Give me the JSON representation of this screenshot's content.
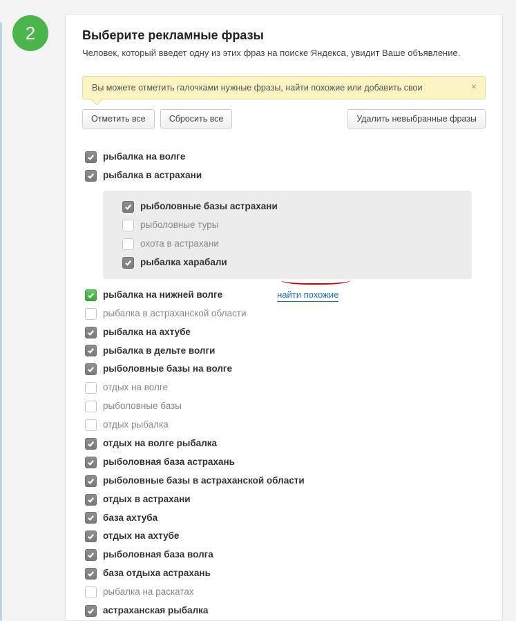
{
  "step_number": "2",
  "title": "Выберите рекламные фразы",
  "subtitle": "Человек, который введет одну из этих фраз на поиске Яндекса, увидит Ваше объявление.",
  "hint": "Вы можете отметить галочками нужные фразы, найти похожие или добавить свои",
  "buttons": {
    "select_all": "Отметить все",
    "reset_all": "Сбросить все",
    "delete_unselected": "Удалить невыбранные фразы"
  },
  "link_similar": "найти похожие",
  "phrases_top": [
    {
      "label": "рыбалка на волге",
      "state": "checked-grey"
    },
    {
      "label": "рыбалка в астрахани",
      "state": "checked-grey"
    }
  ],
  "nested_phrases": [
    {
      "label": "рыболовные базы астрахани",
      "state": "checked-grey"
    },
    {
      "label": "рыболовные туры",
      "state": "unchecked"
    },
    {
      "label": "охота в астрахани",
      "state": "unchecked"
    },
    {
      "label": "рыбалка харабали",
      "state": "checked-grey"
    }
  ],
  "phrases_main": [
    {
      "label": "рыбалка на нижней волге",
      "state": "checked-green",
      "link": true
    },
    {
      "label": "рыбалка в астраханской области",
      "state": "unchecked"
    },
    {
      "label": "рыбалка на ахтубе",
      "state": "checked-grey"
    },
    {
      "label": "рыбалка в дельте волги",
      "state": "checked-grey"
    },
    {
      "label": "рыболовные базы на волге",
      "state": "checked-grey"
    },
    {
      "label": "отдых на волге",
      "state": "unchecked"
    },
    {
      "label": "рыболовные базы",
      "state": "unchecked"
    },
    {
      "label": "отдых рыбалка",
      "state": "unchecked"
    },
    {
      "label": "отдых на волге рыбалка",
      "state": "checked-grey"
    },
    {
      "label": "рыболовная база астрахань",
      "state": "checked-grey"
    },
    {
      "label": "рыболовные базы в астраханской области",
      "state": "checked-grey"
    },
    {
      "label": "отдых в астрахани",
      "state": "checked-grey"
    },
    {
      "label": "база ахтуба",
      "state": "checked-grey"
    },
    {
      "label": "отдых на ахтубе",
      "state": "checked-grey"
    },
    {
      "label": "рыболовная база волга",
      "state": "checked-grey"
    },
    {
      "label": "база отдыха астрахань",
      "state": "checked-grey"
    },
    {
      "label": "рыбалка на раскатах",
      "state": "unchecked"
    },
    {
      "label": "астраханская рыбалка",
      "state": "checked-grey"
    }
  ]
}
